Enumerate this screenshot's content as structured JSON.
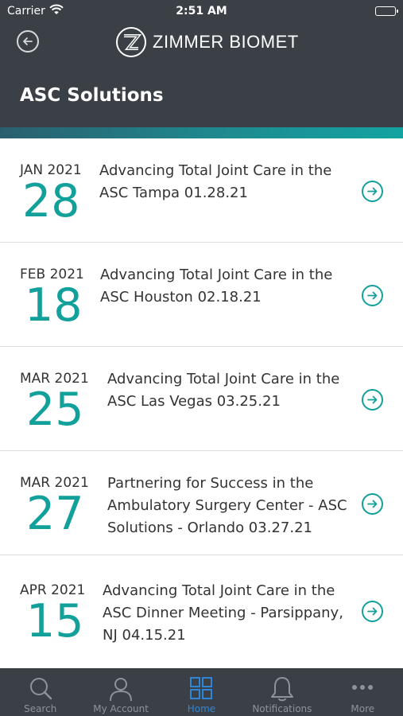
{
  "status_bar": {
    "carrier": "Carrier",
    "time": "2:51 AM"
  },
  "header": {
    "brand": "ZIMMER BIOMET",
    "title": "ASC Solutions"
  },
  "events": [
    {
      "month": "JAN 2021",
      "day": "28",
      "title_lines": [
        "Advancing Total Joint Care in the",
        "ASC Tampa 01.28.21"
      ]
    },
    {
      "month": "FEB 2021",
      "day": "18",
      "title_lines": [
        "Advancing Total Joint Care in the",
        "ASC Houston 02.18.21"
      ]
    },
    {
      "month": "MAR 2021",
      "day": "25",
      "title_lines": [
        "Advancing Total Joint Care in the",
        "ASC Las Vegas 03.25.21"
      ]
    },
    {
      "month": "MAR 2021",
      "day": "27",
      "title_lines": [
        "Partnering for Success in the",
        "Ambulatory Surgery Center - ASC",
        "Solutions - Orlando 03.27.21"
      ]
    },
    {
      "month": "APR 2021",
      "day": "15",
      "title_lines": [
        "Advancing Total Joint Care in the",
        "ASC Dinner Meeting - Parsippany,",
        "NJ 04.15.21"
      ]
    }
  ],
  "tabs": [
    {
      "label": "Search",
      "icon": "search-icon"
    },
    {
      "label": "My Account",
      "icon": "user-icon"
    },
    {
      "label": "Home",
      "icon": "grid-icon",
      "active": true
    },
    {
      "label": "Notifications",
      "icon": "bell-icon"
    },
    {
      "label": "More",
      "icon": "more-icon"
    }
  ],
  "colors": {
    "header": "#3b4046",
    "accent": "#12a09b",
    "tab_active": "#2f86d6",
    "tab_inactive": "#8e9399"
  }
}
